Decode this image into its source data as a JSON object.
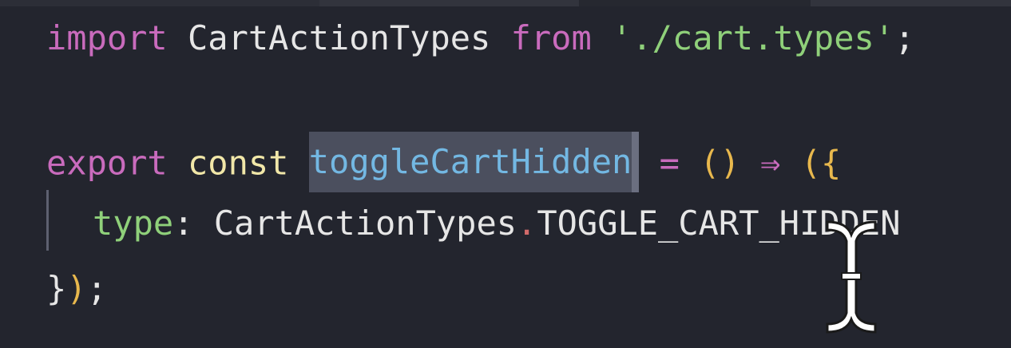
{
  "editor": {
    "line1": {
      "kw_import": "import",
      "ident": "CartActionTypes",
      "kw_from": "from",
      "string": "'./cart.types'",
      "semicolon": ";"
    },
    "line2": {
      "kw_export": "export",
      "kw_const": "const",
      "fn_name": "toggleCartHidden",
      "equals": "=",
      "parens": "()",
      "arrow": "⇒",
      "open": "({"
    },
    "line3": {
      "prop": "type",
      "colon": ":",
      "obj": "CartActionTypes",
      "dot": ".",
      "member": "TOGGLE_CART_HIDDEN"
    },
    "line4": {
      "brace": "}",
      "paren": ")",
      "semicolon": ";"
    }
  },
  "colors": {
    "background": "#23252e",
    "keyword": "#c96bbd",
    "function": "#73b8e3",
    "string": "#8fd07a",
    "bracket": "#e8b84d",
    "selection": "#4b4f5e"
  },
  "cursor": {
    "icon": "text-ibeam-cursor-icon"
  }
}
